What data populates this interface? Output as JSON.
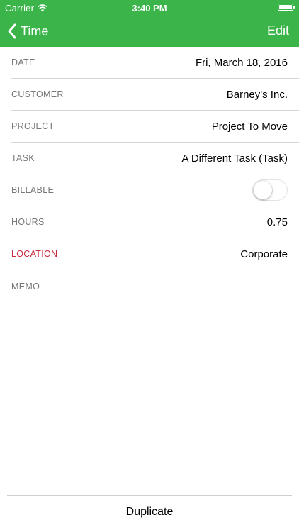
{
  "status_bar": {
    "carrier": "Carrier",
    "time": "3:40 PM"
  },
  "nav": {
    "back_label": "Time",
    "edit_label": "Edit"
  },
  "fields": {
    "date": {
      "label": "DATE",
      "value": "Fri, March 18, 2016"
    },
    "customer": {
      "label": "CUSTOMER",
      "value": "Barney's Inc."
    },
    "project": {
      "label": "PROJECT",
      "value": "Project To Move"
    },
    "task": {
      "label": "TASK",
      "value": "A Different Task (Task)"
    },
    "billable": {
      "label": "BILLABLE",
      "value": false
    },
    "hours": {
      "label": "HOURS",
      "value": "0.75"
    },
    "location": {
      "label": "LOCATION",
      "value": "Corporate"
    },
    "memo": {
      "label": "MEMO",
      "value": ""
    }
  },
  "footer": {
    "duplicate_label": "Duplicate"
  },
  "colors": {
    "header_green": "#3bb54a",
    "location_label_red": "#c8283c"
  },
  "icons": {
    "wifi": "wifi-icon",
    "battery": "battery-icon",
    "back": "chevron-left-icon"
  }
}
